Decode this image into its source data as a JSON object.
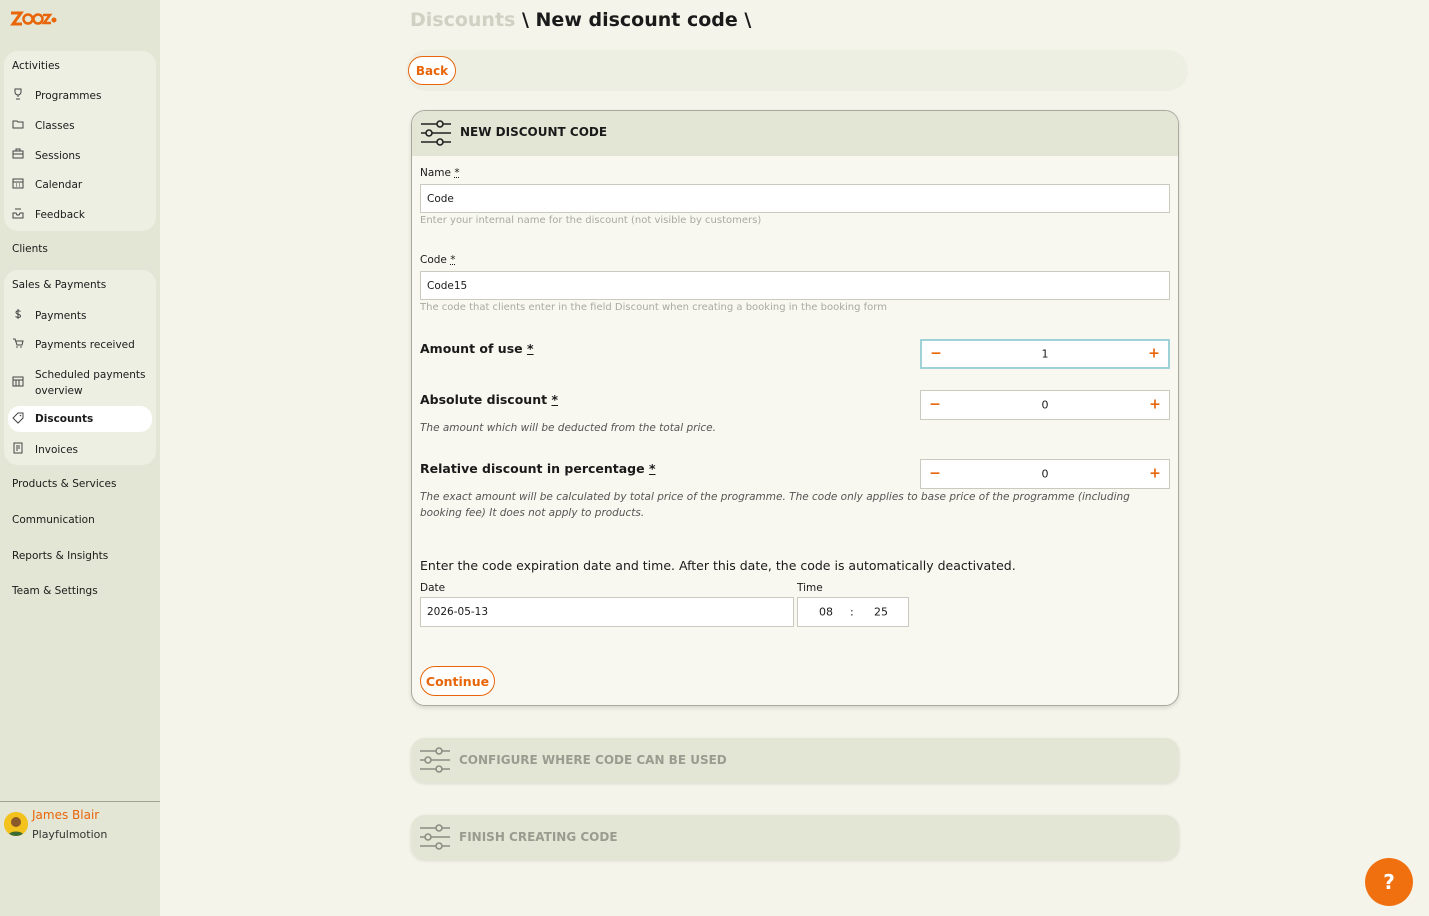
{
  "brand": {
    "logo_text": "Zooza",
    "accent": "#e8650a"
  },
  "sidebar": {
    "activities_heading": "Activities",
    "activities": [
      {
        "label": "Programmes",
        "icon": "trophy-icon"
      },
      {
        "label": "Classes",
        "icon": "folder-icon"
      },
      {
        "label": "Sessions",
        "icon": "briefcase-icon"
      },
      {
        "label": "Calendar",
        "icon": "calendar-icon"
      },
      {
        "label": "Feedback",
        "icon": "inbox-icon"
      }
    ],
    "clients": "Clients",
    "sales_heading": "Sales & Payments",
    "sales": [
      {
        "label": "Payments",
        "icon": "dollar-icon"
      },
      {
        "label": "Payments received",
        "icon": "cart-icon"
      },
      {
        "label": "Scheduled payments overview",
        "icon": "calendar-grid-icon"
      },
      {
        "label": "Discounts",
        "icon": "tag-icon",
        "active": true
      },
      {
        "label": "Invoices",
        "icon": "invoice-icon"
      }
    ],
    "products": "Products & Services",
    "communication": "Communication",
    "reports": "Reports & Insights",
    "team": "Team & Settings",
    "user": {
      "name": "James Blair",
      "org": "Playfulmotion"
    }
  },
  "breadcrumb": {
    "parent": "Discounts",
    "sep1": " \\ ",
    "current": "New discount code",
    "sep2": " \\"
  },
  "back_label": "Back",
  "form": {
    "title": "NEW DISCOUNT CODE",
    "name_label": "Name",
    "name_value": "Code",
    "name_hint": "Enter your internal name for the discount (not visible by customers)",
    "code_label": "Code",
    "code_value": "Code15",
    "code_hint": "The code that clients enter in the field Discount when creating a booking in the booking form",
    "amount_label": "Amount of use",
    "amount_value": "1",
    "absolute_label": "Absolute discount",
    "absolute_value": "0",
    "absolute_hint": "The amount which will be deducted from the total price.",
    "relative_label": "Relative discount in percentage",
    "relative_value": "0",
    "relative_hint": "The exact amount will be calculated by total price of the programme. The code only applies to base price of the programme (including booking fee) It does not apply to products.",
    "required_mark": "*",
    "minus": "−",
    "plus": "+",
    "expiry_text": "Enter the code expiration date and time. After this date, the code is automatically deactivated.",
    "date_label": "Date",
    "date_value": "2026-05-13",
    "time_label": "Time",
    "time_hour": "08",
    "time_sep": ":",
    "time_minute": "25",
    "continue_label": "Continue"
  },
  "steps": {
    "configure": "CONFIGURE WHERE CODE CAN BE USED",
    "finish": "FINISH CREATING CODE"
  },
  "help_icon": "?"
}
